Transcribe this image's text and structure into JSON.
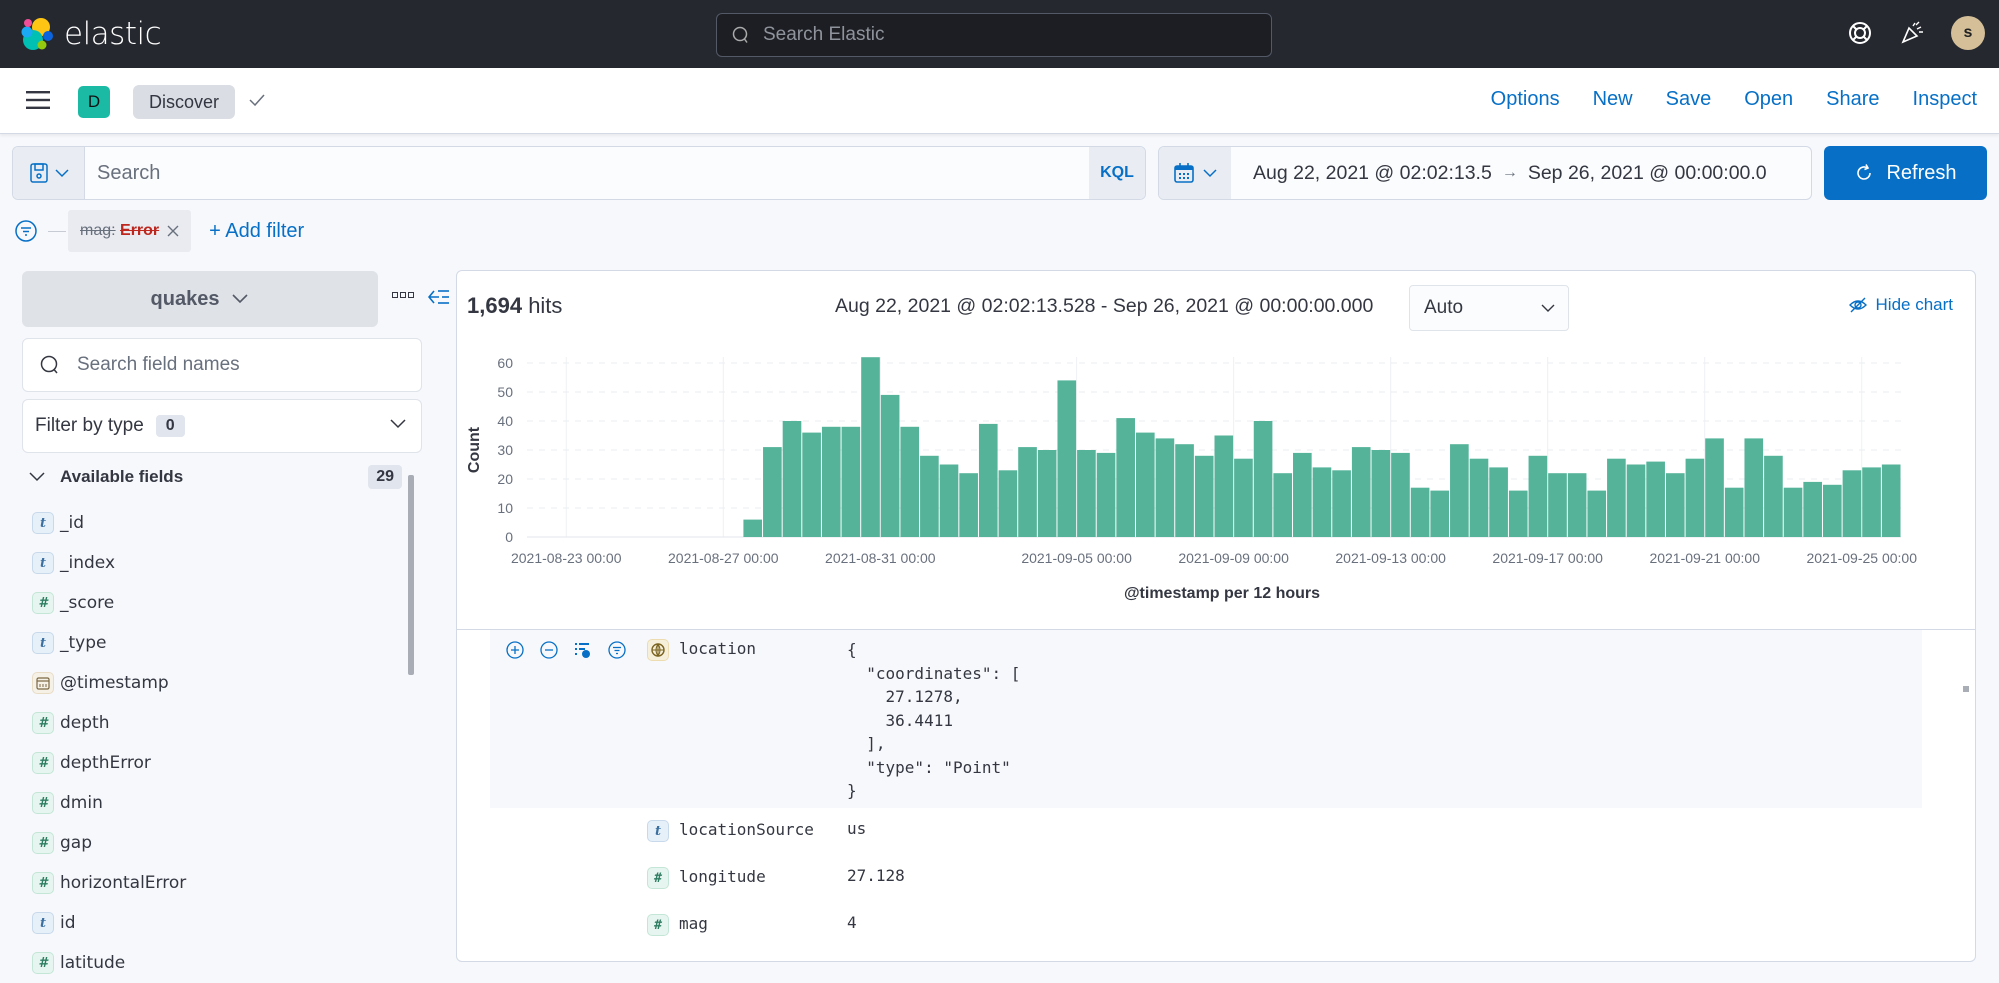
{
  "header": {
    "brand": "elastic",
    "search_placeholder": "Search Elastic",
    "avatar_initial": "s"
  },
  "navbar": {
    "app_badge": "D",
    "app_name": "Discover",
    "links": [
      "Options",
      "New",
      "Save",
      "Open",
      "Share",
      "Inspect"
    ]
  },
  "query": {
    "placeholder": "Search",
    "language": "KQL",
    "time_start": "Aug 22, 2021 @ 02:02:13.5",
    "time_end": "Sep 26, 2021 @ 00:00:00.0",
    "refresh_label": "Refresh"
  },
  "filters": {
    "pill_key": "mag:",
    "pill_value": "Error",
    "add_filter_label": "+ Add filter"
  },
  "sidebar": {
    "index_pattern": "quakes",
    "field_search_placeholder": "Search field names",
    "filter_by_type_label": "Filter by type",
    "filter_by_type_count": "0",
    "available_fields_label": "Available fields",
    "available_fields_count": "29",
    "fields": [
      {
        "type": "t",
        "name": "_id"
      },
      {
        "type": "t",
        "name": "_index"
      },
      {
        "type": "n",
        "name": "_score"
      },
      {
        "type": "t",
        "name": "_type"
      },
      {
        "type": "d",
        "name": "@timestamp"
      },
      {
        "type": "n",
        "name": "depth"
      },
      {
        "type": "n",
        "name": "depthError"
      },
      {
        "type": "n",
        "name": "dmin"
      },
      {
        "type": "n",
        "name": "gap"
      },
      {
        "type": "n",
        "name": "horizontalError"
      },
      {
        "type": "t",
        "name": "id"
      },
      {
        "type": "n",
        "name": "latitude"
      }
    ]
  },
  "results": {
    "hits_count": "1,694",
    "hits_label": "hits",
    "time_range_label": "Aug 22, 2021 @ 02:02:13.528 - Sep 26, 2021 @ 00:00:00.000",
    "interval": "Auto",
    "hide_chart_label": "Hide chart"
  },
  "chart_data": {
    "type": "bar",
    "title": "",
    "xlabel": "@timestamp per 12 hours",
    "ylabel": "Count",
    "ylim": [
      0,
      60
    ],
    "yticks": [
      0,
      10,
      20,
      30,
      40,
      50,
      60
    ],
    "x_range": [
      "2021-08-22 00:00",
      "2021-09-26 00:00"
    ],
    "bin_hours": 12,
    "first_bar": "2021-08-27 12:00",
    "xtick_labels": [
      "2021-08-23 00:00",
      "2021-08-27 00:00",
      "2021-08-31 00:00",
      "2021-09-05 00:00",
      "2021-09-09 00:00",
      "2021-09-13 00:00",
      "2021-09-17 00:00",
      "2021-09-21 00:00",
      "2021-09-25 00:00"
    ],
    "color": "#54b399",
    "values": [
      6,
      31,
      40,
      36,
      38,
      38,
      62,
      49,
      38,
      28,
      25,
      22,
      39,
      23,
      31,
      30,
      54,
      30,
      29,
      41,
      36,
      34,
      32,
      28,
      35,
      27,
      40,
      22,
      29,
      24,
      23,
      31,
      30,
      29,
      17,
      16,
      32,
      27,
      24,
      16,
      28,
      22,
      22,
      16,
      27,
      25,
      26,
      22,
      27,
      34,
      17,
      34,
      28,
      17,
      19,
      18,
      23,
      24,
      25
    ],
    "grid": true
  },
  "document": {
    "location": {
      "name": "location",
      "value": "{\n  \"coordinates\": [\n    27.1278,\n    36.4411\n  ],\n  \"type\": \"Point\"\n}"
    },
    "rows": [
      {
        "type": "t",
        "name": "locationSource",
        "value": "us"
      },
      {
        "type": "n",
        "name": "longitude",
        "value": "27.128"
      },
      {
        "type": "n",
        "name": "mag",
        "value": "4"
      }
    ]
  }
}
